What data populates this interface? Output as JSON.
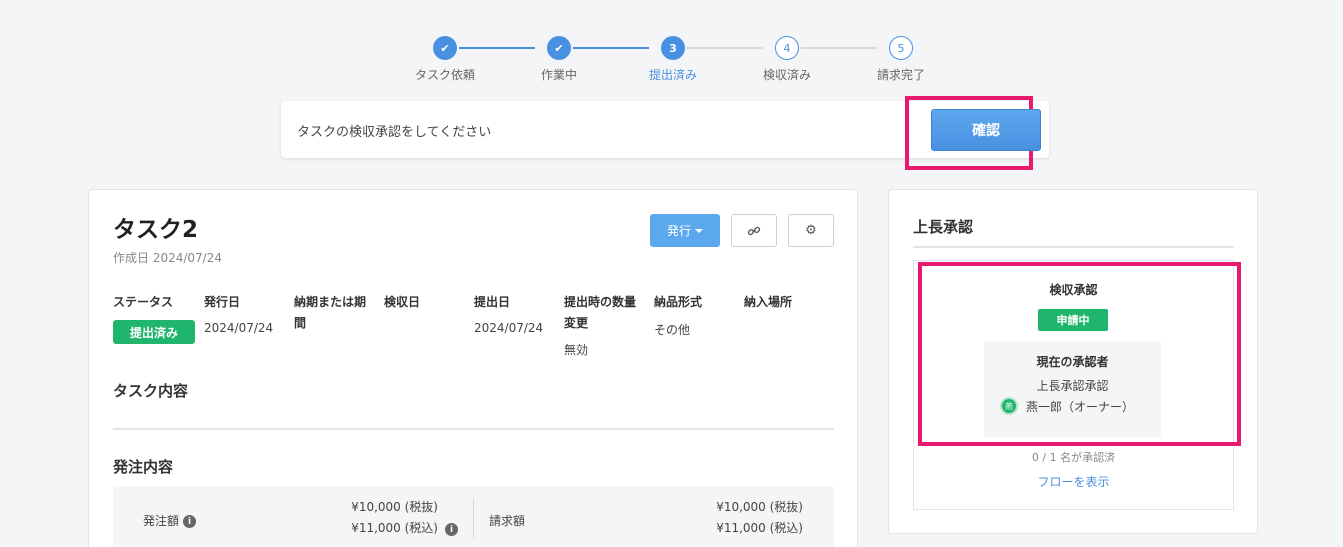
{
  "stepper": {
    "steps": [
      {
        "num": "1",
        "label": "タスク依頼",
        "state": "done"
      },
      {
        "num": "2",
        "label": "作業中",
        "state": "done"
      },
      {
        "num": "3",
        "label": "提出済み",
        "state": "active"
      },
      {
        "num": "4",
        "label": "検収済み",
        "state": "todo"
      },
      {
        "num": "5",
        "label": "請求完了",
        "state": "todo"
      }
    ]
  },
  "notice": {
    "message": "タスクの検収承認をしてください",
    "confirm_label": "確認"
  },
  "task": {
    "title": "タスク2",
    "created": "作成日 2024/07/24",
    "issue_label": "発行",
    "fields": {
      "status_h": "ステータス",
      "status_v": "提出済み",
      "issued_h": "発行日",
      "issued_v": "2024/07/24",
      "due_h": "納期または期間",
      "inspect_h": "検収日",
      "submit_h": "提出日",
      "submit_v": "2024/07/24",
      "qty_h": "提出時の数量変更",
      "qty_v": "無効",
      "format_h": "納品形式",
      "format_v": "その他",
      "place_h": "納入場所"
    },
    "content_h": "タスク内容",
    "order_h": "発注内容",
    "order": {
      "order_label": "発注額",
      "order_ex": "¥10,000 (税抜)",
      "order_in": "¥11,000 (税込)",
      "invoice_label": "請求額",
      "invoice_ex": "¥10,000 (税抜)",
      "invoice_in": "¥11,000 (税込)"
    }
  },
  "approval": {
    "title": "上長承認",
    "box_title": "検収承認",
    "badge": "申請中",
    "current_h": "現在の承認者",
    "role": "上長承認承認",
    "avatar": "燕",
    "user": "燕一郎（オーナー）",
    "count": "0 / 1 名が承認済",
    "link": "フローを表示"
  },
  "colors": {
    "accent": "#4a90e2",
    "success": "#20b56d",
    "highlight": "#e8196e"
  }
}
